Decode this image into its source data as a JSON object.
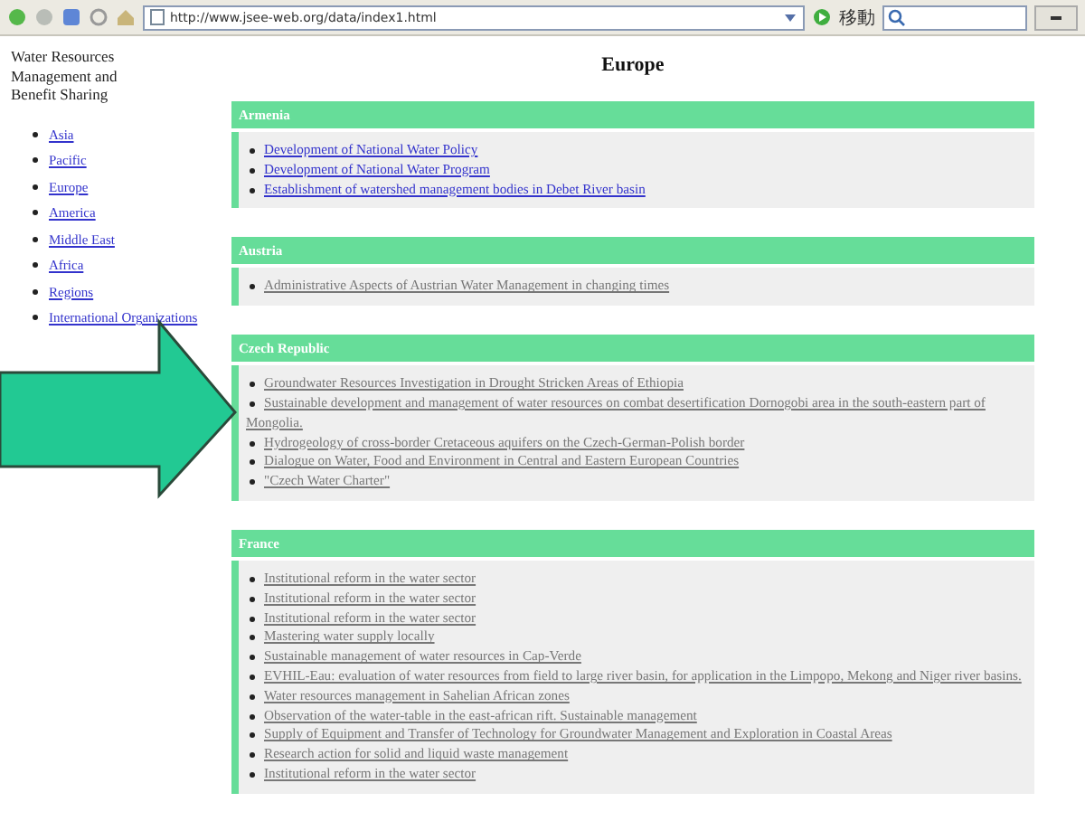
{
  "toolbar": {
    "address": "http://www.jsee-web.org/data/index1.html",
    "go_label": "移動"
  },
  "sidebar": {
    "title": "Water Resources Management and Benefit Sharing",
    "links": [
      {
        "label": "Asia"
      },
      {
        "label": "Pacific"
      },
      {
        "label": "Europe"
      },
      {
        "label": "America"
      },
      {
        "label": "Middle East"
      },
      {
        "label": "Africa"
      },
      {
        "label": "Regions"
      },
      {
        "label": "International Organizations"
      }
    ]
  },
  "page_title": "Europe",
  "sections": [
    {
      "title": "Armenia",
      "links": [
        {
          "label": "Development of National Water Policy",
          "visited": false
        },
        {
          "label": "Development of National Water Program",
          "visited": false
        },
        {
          "label": "Establishment of watershed management bodies in Debet River basin",
          "visited": false
        }
      ]
    },
    {
      "title": "Austria",
      "links": [
        {
          "label": "Administrative Aspects of Austrian Water Management in changing times",
          "visited": true
        }
      ]
    },
    {
      "title": "Czech Republic",
      "links": [
        {
          "label": "Groundwater Resources Investigation in Drought Stricken Areas of Ethiopia",
          "visited": true
        },
        {
          "label": "Sustainable development and management of water resources on combat desertification Dornogobi area in the south-eastern part of Mongolia.",
          "visited": true
        },
        {
          "label": "Hydrogeology of cross-border Cretaceous aquifers on the Czech-German-Polish border",
          "visited": true
        },
        {
          "label": "Dialogue on Water, Food and Environment in Central and Eastern European Countries",
          "visited": true
        },
        {
          "label": "\"Czech Water Charter\"",
          "visited": true
        }
      ]
    },
    {
      "title": "France",
      "links": [
        {
          "label": "Institutional reform in the water sector",
          "visited": true
        },
        {
          "label": "Institutional reform in the water sector",
          "visited": true
        },
        {
          "label": "Institutional reform in the water sector",
          "visited": true
        },
        {
          "label": "Mastering water supply locally",
          "visited": true
        },
        {
          "label": "Sustainable management of water resources in Cap-Verde",
          "visited": true
        },
        {
          "label": "EVHIL-Eau: evaluation of water resources from field to large river basin, for application in the Limpopo, Mekong and Niger river basins.",
          "visited": true
        },
        {
          "label": "Water resources management in Sahelian African zones",
          "visited": true
        },
        {
          "label": "Observation of the water-table in the east-african rift. Sustainable management",
          "visited": true
        },
        {
          "label": "Supply of Equipment and Transfer of Technology for Groundwater Management and Exploration in Coastal Areas",
          "visited": true
        },
        {
          "label": "Research action for solid and liquid waste management",
          "visited": true
        },
        {
          "label": "Institutional reform in the water sector",
          "visited": true
        }
      ]
    }
  ]
}
